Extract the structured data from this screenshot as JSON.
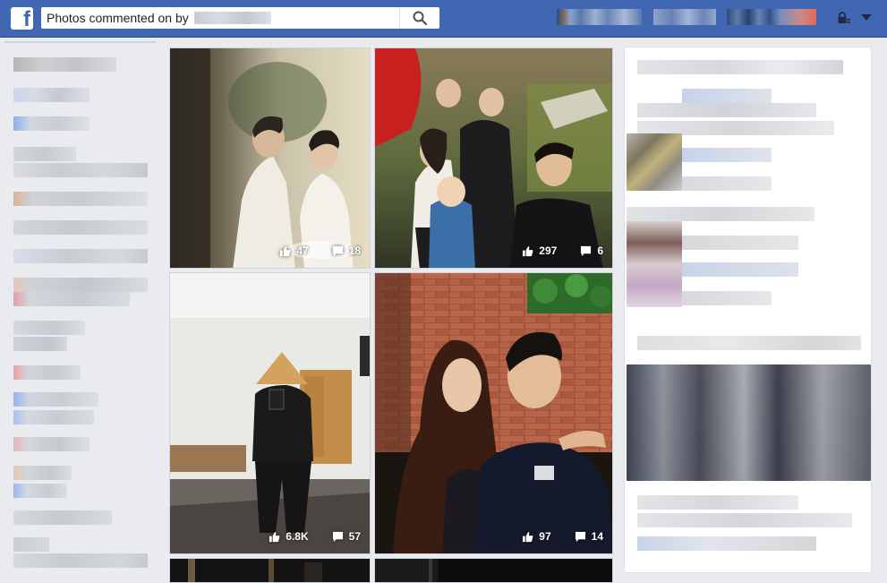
{
  "header": {
    "logo_letter": "f",
    "search_value": "Photos commented on by"
  },
  "icons": {
    "logo": "facebook-logo-icon",
    "search": "search-icon",
    "privacy": "privacy-shortcuts-lock-icon",
    "menu": "account-menu-caret-icon",
    "like": "thumbs-up-icon",
    "comment": "comment-bubble-icon"
  },
  "photos": [
    {
      "likes": "47",
      "comments": "18"
    },
    {
      "likes": "297",
      "comments": "6"
    },
    {
      "likes": "6.8K",
      "comments": "57"
    },
    {
      "likes": "97",
      "comments": "14"
    }
  ],
  "colors": {
    "brand_blue": "#4267b2",
    "page_bg": "#e9ebee"
  }
}
